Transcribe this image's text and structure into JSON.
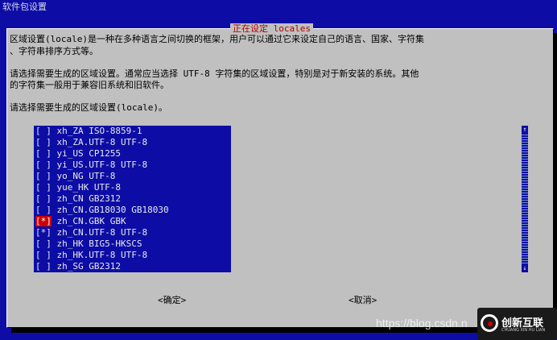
{
  "window": {
    "title": "软件包设置"
  },
  "dialog": {
    "title": "正在设定 locales",
    "description_1_line1": "区域设置(locale)是一种在多种语言之间切换的框架，用户可以通过它来设定自己的语言、国家、字符集",
    "description_1_line2": "、字符串排序方式等。",
    "description_2_line1": "请选择需要生成的区域设置。通常应当选择 UTF-8 字符集的区域设置，特别是对于新安装的系统。其他",
    "description_2_line2": "的字符集一般用于兼容旧系统和旧软件。",
    "prompt": "请选择需要生成的区域设置(locale)。",
    "locale_list": [
      {
        "mark": "[ ]",
        "name": "xh_ZA ISO-8859-1",
        "active": false
      },
      {
        "mark": "[ ]",
        "name": "xh_ZA.UTF-8 UTF-8",
        "active": false
      },
      {
        "mark": "[ ]",
        "name": "yi_US CP1255",
        "active": false
      },
      {
        "mark": "[ ]",
        "name": "yi_US.UTF-8 UTF-8",
        "active": false
      },
      {
        "mark": "[ ]",
        "name": "yo_NG UTF-8",
        "active": false
      },
      {
        "mark": "[ ]",
        "name": "yue_HK UTF-8",
        "active": false
      },
      {
        "mark": "[ ]",
        "name": "zh_CN GB2312",
        "active": false
      },
      {
        "mark": "[ ]",
        "name": "zh_CN.GB18030 GB18030",
        "active": false
      },
      {
        "mark": "[*]",
        "name": "zh_CN.GBK GBK",
        "active": true
      },
      {
        "mark": "[*]",
        "name": "zh_CN.UTF-8 UTF-8",
        "active": false
      },
      {
        "mark": "[ ]",
        "name": "zh_HK BIG5-HKSCS",
        "active": false
      },
      {
        "mark": "[ ]",
        "name": "zh_HK.UTF-8 UTF-8",
        "active": false
      },
      {
        "mark": "[ ]",
        "name": "zh_SG GB2312",
        "active": false
      }
    ],
    "scroll_up_icon": "↑",
    "scroll_down_icon": "↓",
    "ok_label": "<确定>",
    "cancel_label": "<取消>"
  },
  "watermark": {
    "url": "https://blog.csdn.n",
    "logo_text": "创新互联",
    "logo_subtext": "CHUANG XIN HU LIAN"
  },
  "colors": {
    "background": "#0d0da6",
    "dialog": "#c0c0c0",
    "title": "#b00000",
    "selected_mark": "#d00000"
  }
}
